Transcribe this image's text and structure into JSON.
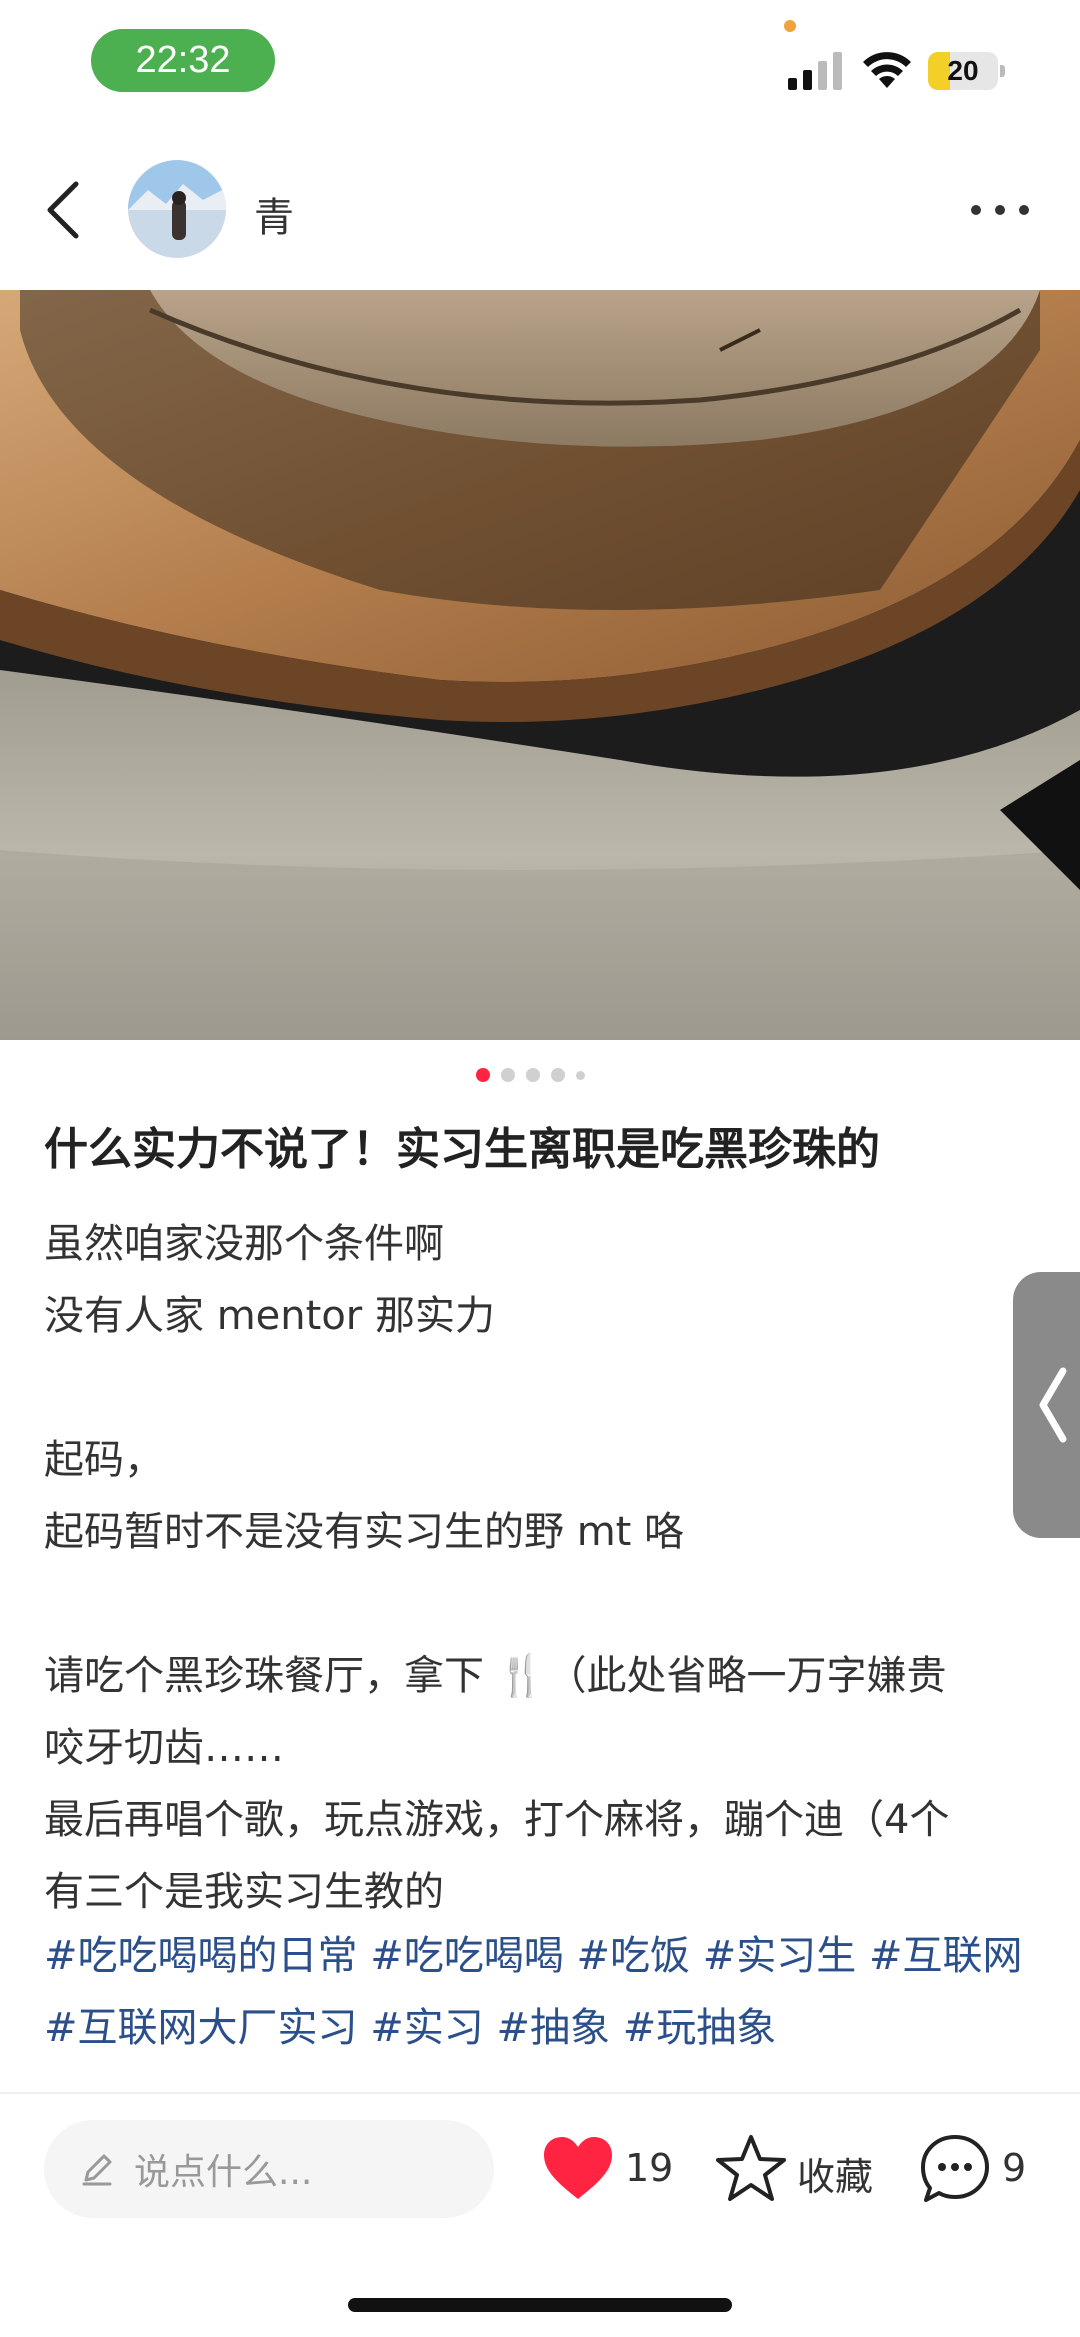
{
  "status_bar": {
    "time": "22:32",
    "battery": "20"
  },
  "header": {
    "author": "青"
  },
  "carousel": {
    "count": 5,
    "active_index": 0
  },
  "post": {
    "title": "什么实力不说了！实习生离职是吃黑珍珠的",
    "lines": [
      "虽然咱家没那个条件啊",
      "没有人家 mentor 那实力",
      "",
      "起码，",
      "起码暂时不是没有实习生的野 mt 咯",
      "",
      "请吃个黑珍珠餐厅，拿下 🍴（此处省略一万字嫌贵",
      "咬牙切齿……",
      "最后再唱个歌，玩点游戏，打个麻将，蹦个迪（4个",
      "有三个是我实习生教的"
    ],
    "tags": [
      "#吃吃喝喝的日常",
      "#吃吃喝喝",
      "#吃饭",
      "#实习生",
      "#互联网",
      "#互联网大厂实习",
      "#实习",
      "#抽象",
      "#玩抽象"
    ]
  },
  "bottom_bar": {
    "comment_placeholder": "说点什么...",
    "likes": "19",
    "collect_label": "收藏",
    "comments": "9"
  },
  "colors": {
    "accent": "#FF2442",
    "tag": "#2B4F8A",
    "time_pill": "#4CAF50"
  }
}
